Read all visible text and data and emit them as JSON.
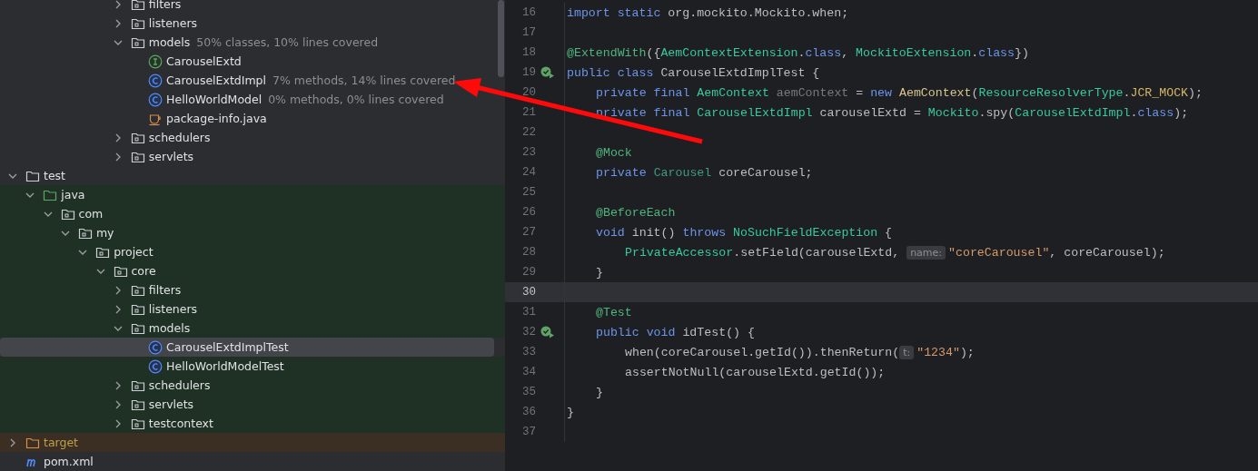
{
  "project_tree": {
    "partial_top": [
      {
        "name": "filters",
        "kind": "package",
        "expanded": false,
        "selected": false
      },
      {
        "name": "listeners",
        "kind": "package",
        "expanded": false,
        "selected": false
      },
      {
        "name": "models",
        "kind": "package",
        "expanded": true,
        "selected": false,
        "coverage": "50% classes, 10% lines covered",
        "children": [
          {
            "name": "CarouselExtd",
            "kind": "interface",
            "selected": false
          },
          {
            "name": "CarouselExtdImpl",
            "kind": "class",
            "selected": false,
            "coverage": "7% methods, 14% lines covered"
          },
          {
            "name": "HelloWorldModel",
            "kind": "class",
            "selected": false,
            "coverage": "0% methods, 0% lines covered"
          },
          {
            "name": "package-info.java",
            "kind": "java_file",
            "selected": false
          }
        ]
      },
      {
        "name": "schedulers",
        "kind": "package",
        "expanded": false,
        "selected": false
      },
      {
        "name": "servlets",
        "kind": "package",
        "expanded": false,
        "selected": false
      }
    ],
    "nodes": [
      {
        "name": "test",
        "kind": "folder",
        "expanded": true,
        "selected": false,
        "children": [
          {
            "name": "java",
            "kind": "test_root",
            "expanded": true,
            "selected": false,
            "children": [
              {
                "name": "com",
                "kind": "package",
                "expanded": true,
                "selected": false,
                "children": [
                  {
                    "name": "my",
                    "kind": "package",
                    "expanded": true,
                    "selected": false,
                    "children": [
                      {
                        "name": "project",
                        "kind": "package",
                        "expanded": true,
                        "selected": false,
                        "children": [
                          {
                            "name": "core",
                            "kind": "package",
                            "expanded": true,
                            "selected": false,
                            "children": [
                              {
                                "name": "filters",
                                "kind": "package",
                                "expanded": false,
                                "selected": false
                              },
                              {
                                "name": "listeners",
                                "kind": "package",
                                "expanded": false,
                                "selected": false
                              },
                              {
                                "name": "models",
                                "kind": "package",
                                "expanded": true,
                                "selected": false,
                                "children": [
                                  {
                                    "name": "CarouselExtdImplTest",
                                    "kind": "class",
                                    "selected": true
                                  },
                                  {
                                    "name": "HelloWorldModelTest",
                                    "kind": "class",
                                    "selected": false
                                  }
                                ]
                              },
                              {
                                "name": "schedulers",
                                "kind": "package",
                                "expanded": false,
                                "selected": false
                              },
                              {
                                "name": "servlets",
                                "kind": "package",
                                "expanded": false,
                                "selected": false
                              },
                              {
                                "name": "testcontext",
                                "kind": "package",
                                "expanded": false,
                                "selected": false
                              }
                            ]
                          }
                        ]
                      }
                    ]
                  }
                ]
              }
            ]
          }
        ]
      },
      {
        "name": "target",
        "kind": "excluded_folder",
        "expanded": false,
        "selected": false
      },
      {
        "name": "pom.xml",
        "kind": "maven",
        "selected": false
      }
    ]
  },
  "editor": {
    "lines": [
      {
        "number": "16",
        "kind": "top",
        "run_icon": false,
        "current": false,
        "parts": [
          {
            "kind": "code",
            "tokens": [
              {
                "kind": "kw",
                "text": "import static "
              },
              {
                "kind": "plain",
                "text": "org.mockito.Mockito.when;"
              }
            ]
          }
        ]
      },
      {
        "number": "17",
        "kind": "top",
        "run_icon": false,
        "current": false
      },
      {
        "number": "18",
        "kind": "top",
        "run_icon": false,
        "current": false,
        "parts": [
          {
            "kind": "code",
            "tokens": [
              {
                "kind": "ann",
                "text": "@ExtendWith"
              },
              {
                "kind": "plain",
                "text": "({"
              },
              {
                "kind": "cls",
                "text": "AemContextExtension"
              },
              {
                "kind": "plain",
                "text": "."
              },
              {
                "kind": "kw",
                "text": "class"
              },
              {
                "kind": "plain",
                "text": ", "
              },
              {
                "kind": "cls",
                "text": "MockitoExtension"
              },
              {
                "kind": "plain",
                "text": "."
              },
              {
                "kind": "kw",
                "text": "class"
              },
              {
                "kind": "plain",
                "text": "})"
              }
            ]
          }
        ]
      },
      {
        "number": "19",
        "kind": "top",
        "run_icon": true,
        "current": false,
        "parts": [
          {
            "kind": "code",
            "tokens": [
              {
                "kind": "kw",
                "text": "public class "
              },
              {
                "kind": "plain",
                "text": "CarouselExtdImplTest {"
              }
            ]
          }
        ]
      },
      {
        "number": "20",
        "kind": "member",
        "run_icon": false,
        "current": false,
        "parts": [
          {
            "kind": "code",
            "tokens": [
              {
                "kind": "kw",
                "text": "private final "
              },
              {
                "kind": "cls",
                "text": "AemContext "
              },
              {
                "kind": "unused",
                "text": "aemContext"
              },
              {
                "kind": "plain",
                "text": " = "
              },
              {
                "kind": "kw",
                "text": "new "
              },
              {
                "kind": "ctor",
                "text": "AemContext"
              },
              {
                "kind": "plain",
                "text": "("
              },
              {
                "kind": "cls",
                "text": "ResourceResolverType"
              },
              {
                "kind": "plain",
                "text": "."
              },
              {
                "kind": "fld",
                "text": "JCR_MOCK"
              },
              {
                "kind": "plain",
                "text": ");"
              }
            ]
          }
        ]
      },
      {
        "number": "21",
        "kind": "member",
        "run_icon": false,
        "current": false,
        "parts": [
          {
            "kind": "code",
            "tokens": [
              {
                "kind": "kw",
                "text": "private final "
              },
              {
                "kind": "cls",
                "text": "CarouselExtdImpl "
              },
              {
                "kind": "plain",
                "text": "carouselExtd = "
              },
              {
                "kind": "cls",
                "text": "Mockito"
              },
              {
                "kind": "plain",
                "text": ".spy("
              },
              {
                "kind": "cls",
                "text": "CarouselExtdImpl"
              },
              {
                "kind": "plain",
                "text": "."
              },
              {
                "kind": "kw",
                "text": "class"
              },
              {
                "kind": "plain",
                "text": ");"
              }
            ]
          }
        ]
      },
      {
        "number": "22",
        "kind": "top",
        "run_icon": false,
        "current": false
      },
      {
        "number": "23",
        "kind": "member",
        "run_icon": false,
        "current": false,
        "parts": [
          {
            "kind": "code",
            "tokens": [
              {
                "kind": "ann",
                "text": "@Mock"
              }
            ]
          }
        ]
      },
      {
        "number": "24",
        "kind": "member",
        "run_icon": false,
        "current": false,
        "parts": [
          {
            "kind": "code",
            "tokens": [
              {
                "kind": "kw",
                "text": "private "
              },
              {
                "kind": "iface",
                "text": "Carousel "
              },
              {
                "kind": "plain",
                "text": "coreCarousel;"
              }
            ]
          }
        ]
      },
      {
        "number": "25",
        "kind": "top",
        "run_icon": false,
        "current": false
      },
      {
        "number": "26",
        "kind": "member",
        "run_icon": false,
        "current": false,
        "parts": [
          {
            "kind": "code",
            "tokens": [
              {
                "kind": "ann",
                "text": "@BeforeEach"
              }
            ]
          }
        ]
      },
      {
        "number": "27",
        "kind": "member",
        "run_icon": false,
        "current": false,
        "parts": [
          {
            "kind": "code",
            "tokens": [
              {
                "kind": "kw",
                "text": "void "
              },
              {
                "kind": "plain",
                "text": "init() "
              },
              {
                "kind": "kw",
                "text": "throws "
              },
              {
                "kind": "cls",
                "text": "NoSuchFieldException"
              },
              {
                "kind": "plain",
                "text": " {"
              }
            ]
          }
        ]
      },
      {
        "number": "28",
        "kind": "statement",
        "run_icon": false,
        "current": false,
        "parts": [
          {
            "kind": "code",
            "tokens": [
              {
                "kind": "cls",
                "text": "PrivateAccessor"
              },
              {
                "kind": "plain",
                "text": ".setField(carouselExtd, "
              }
            ]
          },
          {
            "kind": "hint",
            "text": "name:"
          },
          {
            "kind": "code",
            "tokens": [
              {
                "kind": "str",
                "text": "\"coreCarousel\""
              },
              {
                "kind": "plain",
                "text": ", coreCarousel);"
              }
            ]
          }
        ]
      },
      {
        "number": "29",
        "kind": "member",
        "run_icon": false,
        "current": false,
        "parts": [
          {
            "kind": "code",
            "tokens": [
              {
                "kind": "plain",
                "text": "}"
              }
            ]
          }
        ]
      },
      {
        "number": "30",
        "kind": "top",
        "run_icon": false,
        "current": true
      },
      {
        "number": "31",
        "kind": "member",
        "run_icon": false,
        "current": false,
        "parts": [
          {
            "kind": "code",
            "tokens": [
              {
                "kind": "ann",
                "text": "@Test"
              }
            ]
          }
        ]
      },
      {
        "number": "32",
        "kind": "member",
        "run_icon": true,
        "current": false,
        "parts": [
          {
            "kind": "code",
            "tokens": [
              {
                "kind": "kw",
                "text": "public void "
              },
              {
                "kind": "plain",
                "text": "idTest() {"
              }
            ]
          }
        ]
      },
      {
        "number": "33",
        "kind": "statement",
        "run_icon": false,
        "current": false,
        "parts": [
          {
            "kind": "code",
            "tokens": [
              {
                "kind": "plain",
                "text": "when(coreCarousel.getId()).thenReturn("
              }
            ]
          },
          {
            "kind": "hint",
            "text": "t:"
          },
          {
            "kind": "code",
            "tokens": [
              {
                "kind": "str",
                "text": "\"1234\""
              },
              {
                "kind": "plain",
                "text": ");"
              }
            ]
          }
        ]
      },
      {
        "number": "34",
        "kind": "statement",
        "run_icon": false,
        "current": false,
        "parts": [
          {
            "kind": "code",
            "tokens": [
              {
                "kind": "plain",
                "text": "assertNotNull(carouselExtd.getId());"
              }
            ]
          }
        ]
      },
      {
        "number": "35",
        "kind": "member",
        "run_icon": false,
        "current": false,
        "parts": [
          {
            "kind": "code",
            "tokens": [
              {
                "kind": "plain",
                "text": "}"
              }
            ]
          }
        ]
      },
      {
        "number": "36",
        "kind": "top",
        "run_icon": false,
        "current": false,
        "parts": [
          {
            "kind": "code",
            "tokens": [
              {
                "kind": "plain",
                "text": "}"
              }
            ]
          }
        ]
      },
      {
        "number": "37",
        "kind": "top",
        "run_icon": false,
        "current": false
      }
    ]
  },
  "overlay": {
    "kind": "arrow"
  }
}
